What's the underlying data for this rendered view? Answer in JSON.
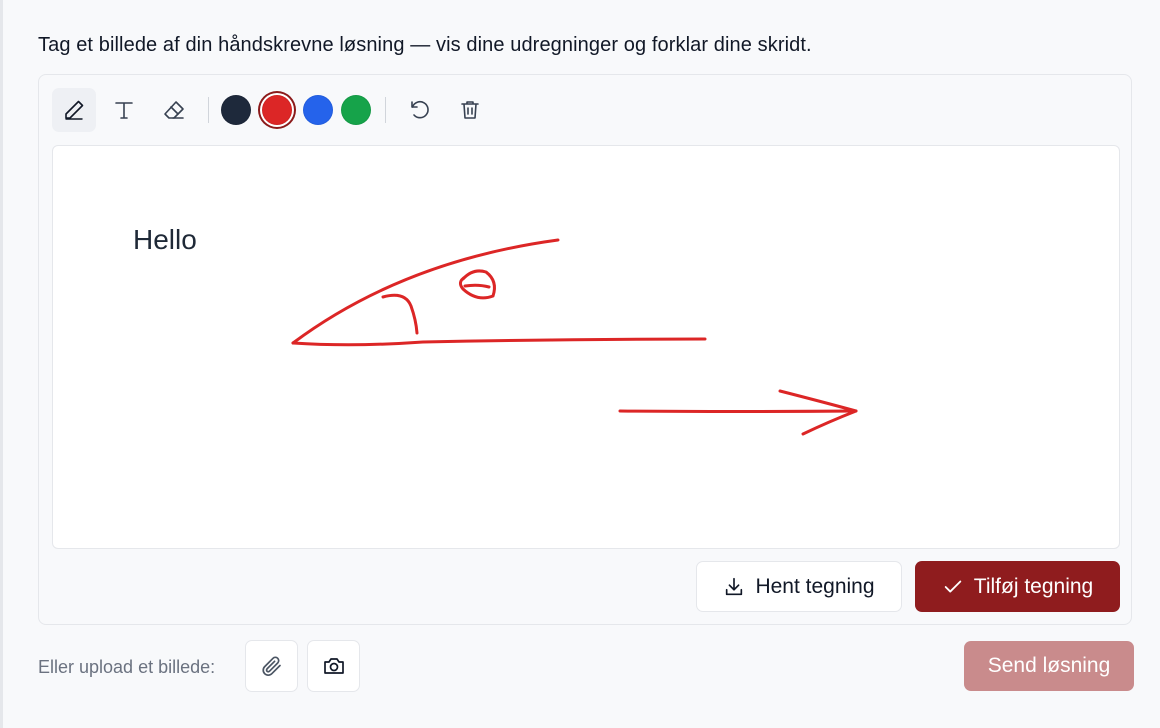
{
  "instructions": "Tag et billede af din håndskrevne løsning — vis dine udregninger og forklar dine skridt.",
  "toolbar": {
    "tools": [
      {
        "name": "pen",
        "icon": "pencil-icon",
        "active": true
      },
      {
        "name": "text",
        "icon": "text-icon",
        "active": false
      },
      {
        "name": "eraser",
        "icon": "eraser-icon",
        "active": false
      }
    ],
    "colors": [
      "#1e293b",
      "#dc2626",
      "#2563eb",
      "#16a34a"
    ],
    "selected_color": "#dc2626",
    "actions": [
      {
        "name": "undo",
        "icon": "undo-icon"
      },
      {
        "name": "clear",
        "icon": "trash-icon"
      }
    ]
  },
  "canvas": {
    "text": "Hello",
    "stroke_color": "#dc2626"
  },
  "buttons": {
    "download_label": "Hent tegning",
    "add_label": "Tilføj tegning",
    "send_label": "Send løsning"
  },
  "upload": {
    "label": "Eller upload et billede:"
  },
  "colors": {
    "accent": "#8f1c1e",
    "send_disabled": "#c98b8c"
  }
}
